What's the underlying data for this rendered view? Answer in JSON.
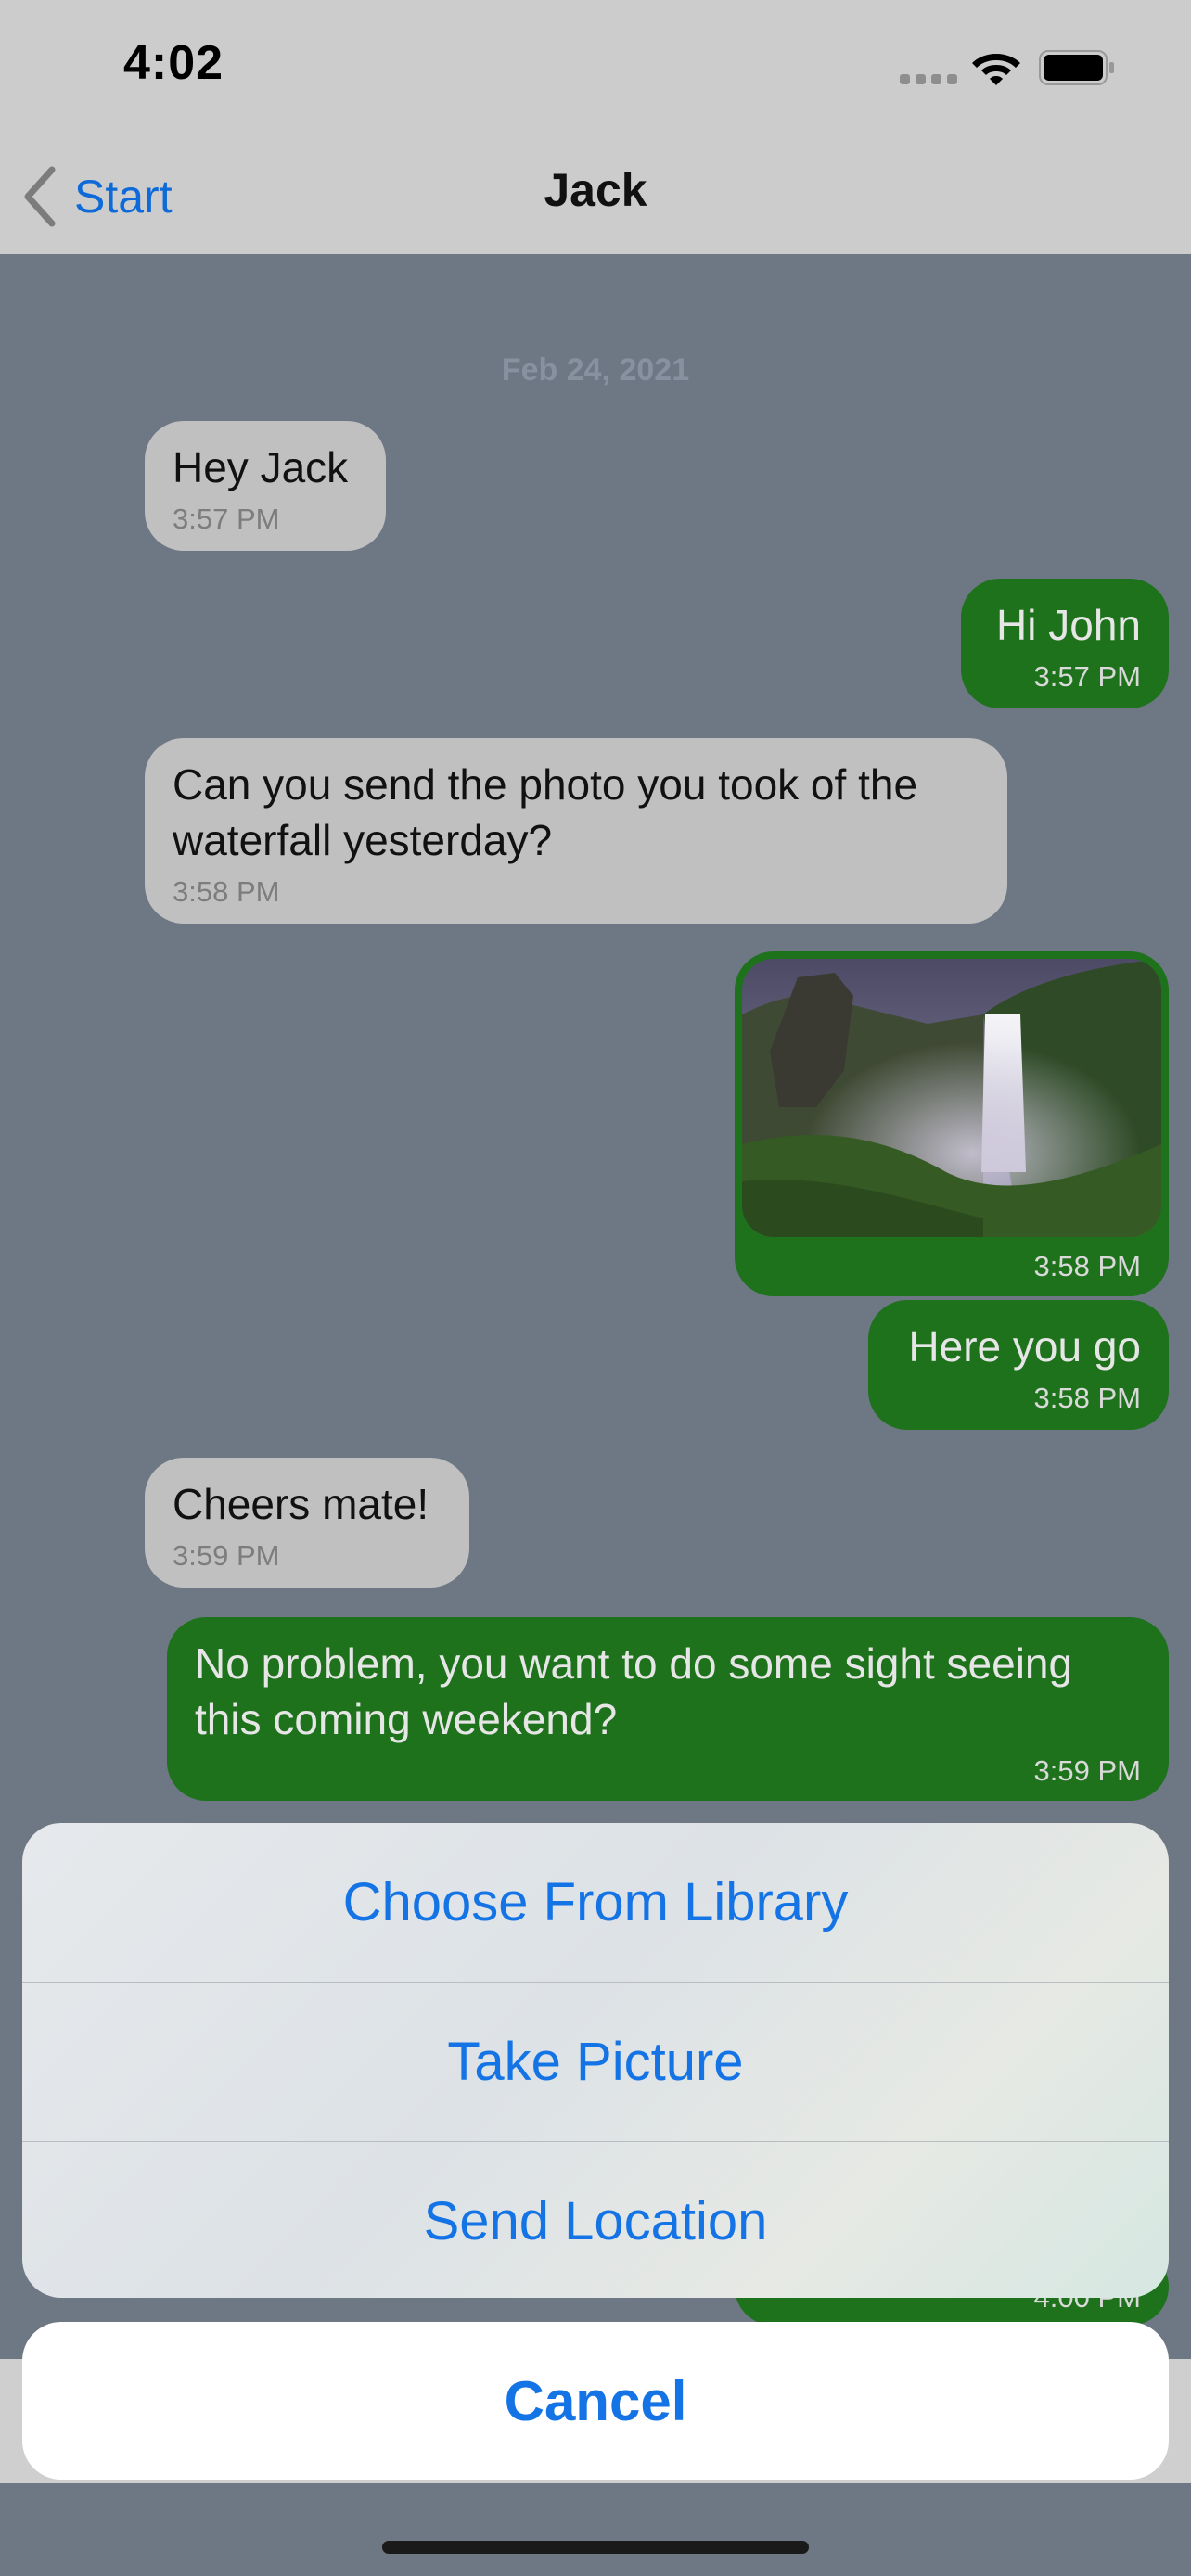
{
  "status_bar": {
    "time": "4:02",
    "icons": [
      "signal-icon",
      "wifi-icon",
      "battery-icon"
    ]
  },
  "nav": {
    "back_label": "Start",
    "title": "Jack"
  },
  "chat": {
    "date": "Feb 24, 2021",
    "messages": [
      {
        "direction": "incoming",
        "text": "Hey Jack",
        "time": "3:57 PM"
      },
      {
        "direction": "outgoing",
        "text": "Hi John",
        "time": "3:57 PM"
      },
      {
        "direction": "incoming",
        "text": "Can you send the photo you took of the waterfall yesterday?",
        "time": "3:58 PM"
      },
      {
        "direction": "outgoing",
        "type": "photo",
        "time": "3:58 PM"
      },
      {
        "direction": "outgoing",
        "text": "Here you go",
        "time": "3:58 PM"
      },
      {
        "direction": "incoming",
        "text": "Cheers mate!",
        "time": "3:59 PM"
      },
      {
        "direction": "outgoing",
        "text": "No problem, you want to do some sight seeing this coming weekend?",
        "time": "3:59 PM"
      },
      {
        "direction": "outgoing",
        "time": "4:00 PM"
      }
    ]
  },
  "action_sheet": {
    "options": [
      "Choose From Library",
      "Take Picture",
      "Send Location"
    ],
    "cancel": "Cancel"
  },
  "colors": {
    "incoming_bubble": "#c0c0c0",
    "outgoing_bubble": "#1e721c",
    "accent": "#1474e6",
    "chat_background": "#6e7784"
  }
}
